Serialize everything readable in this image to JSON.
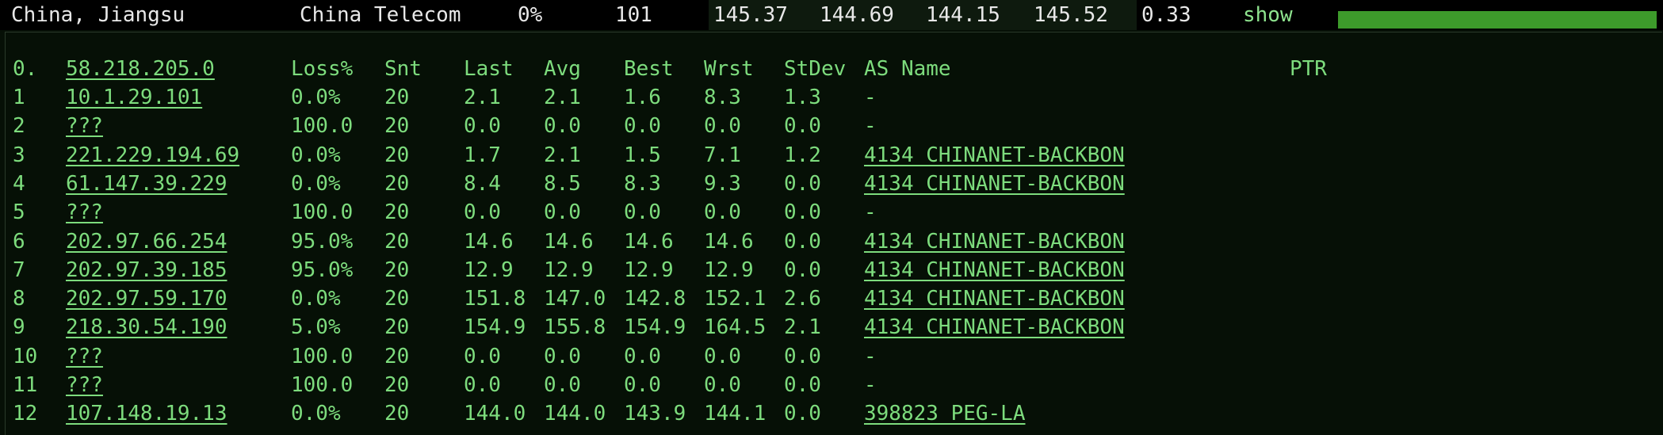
{
  "summary": {
    "location": "China, Jiangsu",
    "isp": "China Telecom",
    "loss": "0%",
    "snt": "101",
    "last": "145.37",
    "avg": "144.69",
    "best": "144.15",
    "worst": "145.52",
    "stdev": "0.33",
    "show_label": "show",
    "bar_fill_fraction": 1.0,
    "bar_color": "#3d9a2b"
  },
  "table": {
    "headers": {
      "hop": "0.",
      "host": "58.218.205.0",
      "loss": "Loss%",
      "snt": "Snt",
      "last": "Last",
      "avg": "Avg",
      "best": "Best",
      "wrst": "Wrst",
      "stdev": "StDev",
      "as_name": "AS Name",
      "ptr": "PTR"
    },
    "rows": [
      {
        "hop": "1",
        "host": "10.1.29.101",
        "loss": "0.0%",
        "snt": "20",
        "last": "2.1",
        "avg": "2.1",
        "best": "1.6",
        "wrst": "8.3",
        "stdev": "1.3",
        "as_name": "-",
        "as_link": false
      },
      {
        "hop": "2",
        "host": "???",
        "loss": "100.0",
        "snt": "20",
        "last": "0.0",
        "avg": "0.0",
        "best": "0.0",
        "wrst": "0.0",
        "stdev": "0.0",
        "as_name": "-",
        "as_link": false
      },
      {
        "hop": "3",
        "host": "221.229.194.69",
        "loss": "0.0%",
        "snt": "20",
        "last": "1.7",
        "avg": "2.1",
        "best": "1.5",
        "wrst": "7.1",
        "stdev": "1.2",
        "as_name": "4134  CHINANET-BACKBON",
        "as_link": true
      },
      {
        "hop": "4",
        "host": "61.147.39.229",
        "loss": "0.0%",
        "snt": "20",
        "last": "8.4",
        "avg": "8.5",
        "best": "8.3",
        "wrst": "9.3",
        "stdev": "0.0",
        "as_name": "4134  CHINANET-BACKBON",
        "as_link": true
      },
      {
        "hop": "5",
        "host": "???",
        "loss": "100.0",
        "snt": "20",
        "last": "0.0",
        "avg": "0.0",
        "best": "0.0",
        "wrst": "0.0",
        "stdev": "0.0",
        "as_name": "-",
        "as_link": false
      },
      {
        "hop": "6",
        "host": "202.97.66.254",
        "loss": "95.0%",
        "snt": "20",
        "last": "14.6",
        "avg": "14.6",
        "best": "14.6",
        "wrst": "14.6",
        "stdev": "0.0",
        "as_name": "4134  CHINANET-BACKBON",
        "as_link": true
      },
      {
        "hop": "7",
        "host": "202.97.39.185",
        "loss": "95.0%",
        "snt": "20",
        "last": "12.9",
        "avg": "12.9",
        "best": "12.9",
        "wrst": "12.9",
        "stdev": "0.0",
        "as_name": "4134  CHINANET-BACKBON",
        "as_link": true
      },
      {
        "hop": "8",
        "host": "202.97.59.170",
        "loss": "0.0%",
        "snt": "20",
        "last": "151.8",
        "avg": "147.0",
        "best": "142.8",
        "wrst": "152.1",
        "stdev": "2.6",
        "as_name": "4134  CHINANET-BACKBON",
        "as_link": true
      },
      {
        "hop": "9",
        "host": "218.30.54.190",
        "loss": "5.0%",
        "snt": "20",
        "last": "154.9",
        "avg": "155.8",
        "best": "154.9",
        "wrst": "164.5",
        "stdev": "2.1",
        "as_name": "4134  CHINANET-BACKBON",
        "as_link": true
      },
      {
        "hop": "10",
        "host": "???",
        "loss": "100.0",
        "snt": "20",
        "last": "0.0",
        "avg": "0.0",
        "best": "0.0",
        "wrst": "0.0",
        "stdev": "0.0",
        "as_name": "-",
        "as_link": false
      },
      {
        "hop": "11",
        "host": "???",
        "loss": "100.0",
        "snt": "20",
        "last": "0.0",
        "avg": "0.0",
        "best": "0.0",
        "wrst": "0.0",
        "stdev": "0.0",
        "as_name": "-",
        "as_link": false
      },
      {
        "hop": "12",
        "host": "107.148.19.13",
        "loss": "0.0%",
        "snt": "20",
        "last": "144.0",
        "avg": "144.0",
        "best": "143.9",
        "wrst": "144.1",
        "stdev": "0.0",
        "as_name": "398823 PEG-LA",
        "as_link": true
      }
    ]
  }
}
